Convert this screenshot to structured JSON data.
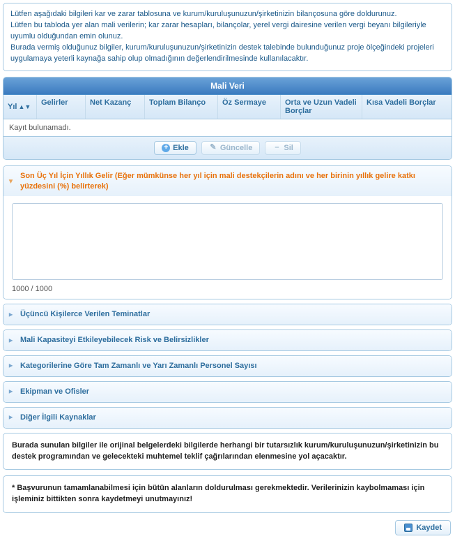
{
  "intro": "Lütfen aşağıdaki bilgileri kar ve zarar tablosuna ve kurum/kuruluşunuzun/şirketinizin bilançosuna göre doldurunuz.\nLütfen bu tabloda yer alan mali verilerin; kar zarar hesapları, bilançolar, yerel vergi dairesine verilen vergi beyanı bilgileriyle uyumlu olduğundan emin olunuz.\nBurada vermiş olduğunuz bilgiler, kurum/kuruluşunuzun/şirketinizin destek talebinde bulunduğunuz proje ölçeğindeki projeleri uygulamaya yeterli kaynağa sahip olup olmadığının değerlendirilmesinde kullanılacaktır.",
  "grid": {
    "title": "Mali Veri",
    "cols": [
      "Yıl",
      "Gelirler",
      "Net Kazanç",
      "Toplam Bilanço",
      "Öz Sermaye",
      "Orta ve Uzun Vadeli Borçlar",
      "Kısa Vadeli Borçlar"
    ],
    "empty": "Kayıt bulunamadı.",
    "btn_add": "Ekle",
    "btn_update": "Güncelle",
    "btn_delete": "Sil"
  },
  "acc": {
    "a1": "Son Üç Yıl İçin Yıllık Gelir (Eğer mümkünse her yıl için mali destekçilerin adını ve her birinin yıllık gelire katkı yüzdesini (%) belirterek)",
    "counter": "1000 / 1000",
    "a2": "Üçüncü Kişilerce Verilen Teminatlar",
    "a3": "Mali Kapasiteyi Etkileyebilecek Risk ve Belirsizlikler",
    "a4": "Kategorilerine Göre Tam Zamanlı ve Yarı Zamanlı Personel Sayısı",
    "a5": "Ekipman ve Ofisler",
    "a6": "Diğer İlgili Kaynaklar"
  },
  "note1": "Burada sunulan bilgiler ile orijinal belgelerdeki bilgilerde herhangi bir tutarsızlık kurum/kuruluşunuzun/şirketinizin bu destek programından ve gelecekteki muhtemel teklif çağrılarından elenmesine yol açacaktır.",
  "note2": "* Başvurunun tamamlanabilmesi için bütün alanların doldurulması gerekmektedir. Verilerinizin kaybolmaması için işleminiz bittikten sonra kaydetmeyi unutmayınız!",
  "save": "Kaydet"
}
